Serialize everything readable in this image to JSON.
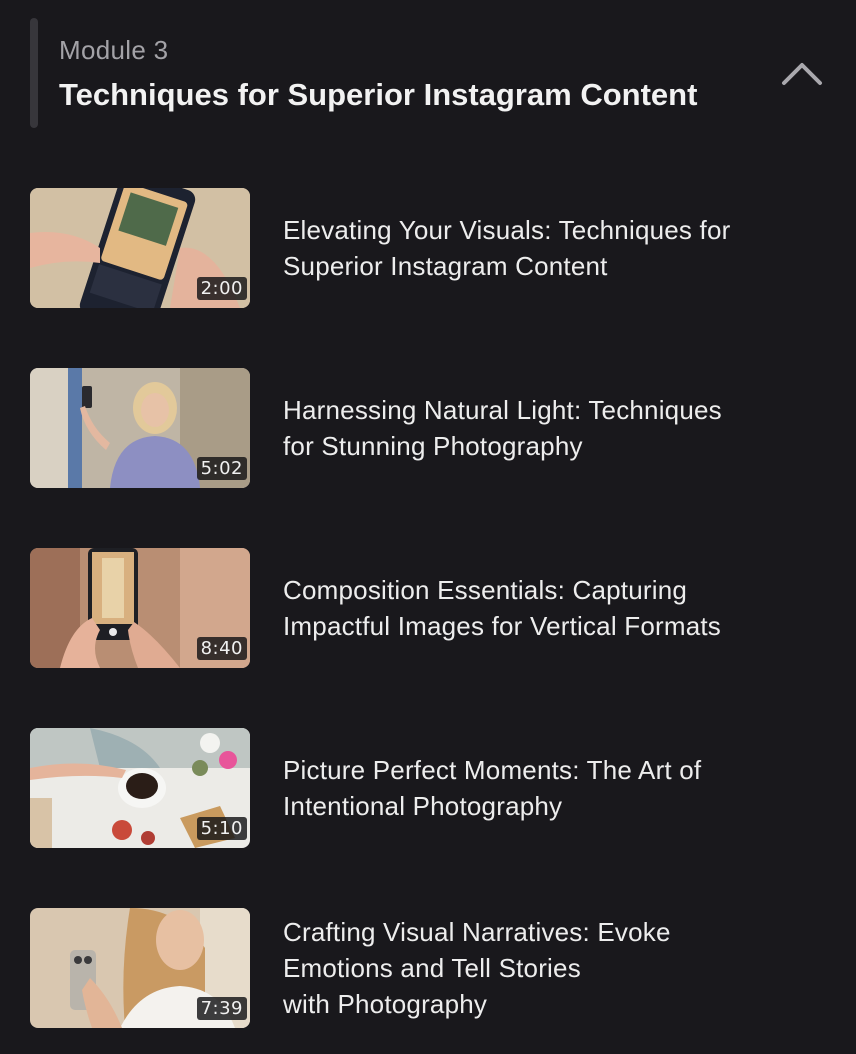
{
  "module": {
    "label": "Module 3",
    "title": "Techniques for Superior Instagram Content",
    "collapse_icon": "chevron-up-icon"
  },
  "lessons": [
    {
      "title_lines": [
        "Elevating Your Visuals: Techniques for",
        "Superior Instagram Content"
      ],
      "duration": "2:00"
    },
    {
      "title_lines": [
        "Harnessing Natural Light: Techniques",
        "for Stunning Photography"
      ],
      "duration": "5:02"
    },
    {
      "title_lines": [
        "Composition Essentials: Capturing",
        "Impactful Images for Vertical Formats"
      ],
      "duration": "8:40"
    },
    {
      "title_lines": [
        "Picture Perfect Moments: The Art of",
        "Intentional Photography"
      ],
      "duration": "5:10"
    },
    {
      "title_lines": [
        "Crafting Visual Narratives: Evoke",
        "Emotions and Tell Stories",
        "with Photography"
      ],
      "duration": "7:39"
    }
  ],
  "colors": {
    "background": "#19181c",
    "accent_bar": "#37363b",
    "text": "#ededed",
    "muted_text": "#a3a2a7"
  }
}
